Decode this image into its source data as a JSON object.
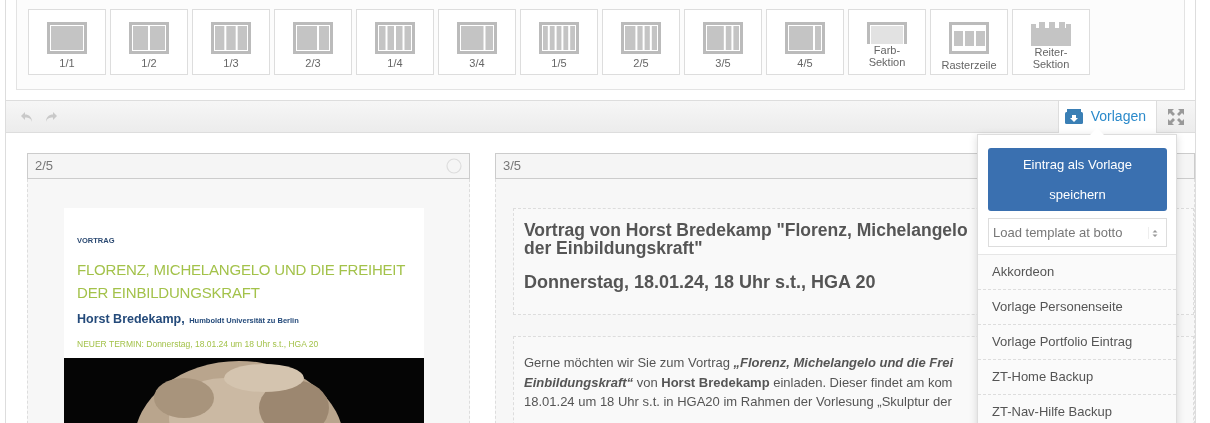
{
  "palette": [
    {
      "label": "1/1",
      "kind": "columns"
    },
    {
      "label": "1/2",
      "kind": "columns"
    },
    {
      "label": "1/3",
      "kind": "columns"
    },
    {
      "label": "2/3",
      "kind": "columns"
    },
    {
      "label": "1/4",
      "kind": "columns"
    },
    {
      "label": "3/4",
      "kind": "columns"
    },
    {
      "label": "1/5",
      "kind": "columns"
    },
    {
      "label": "2/5",
      "kind": "columns"
    },
    {
      "label": "3/5",
      "kind": "columns"
    },
    {
      "label": "4/5",
      "kind": "columns"
    },
    {
      "label": "Farb-\nSektion",
      "kind": "color-section"
    },
    {
      "label": "Rasterzeile",
      "kind": "grid-row"
    },
    {
      "label": "Reiter-\nSektion",
      "kind": "tab-section"
    }
  ],
  "toolbar": {
    "undo_disabled": true,
    "redo_disabled": true,
    "templates_button": "Vorlagen",
    "templates_expanded": true
  },
  "templates_menu": {
    "save_button": "Eintrag als Vorlage speichern",
    "select_value": "Load template at botto",
    "items": [
      "Akkordeon",
      "Vorlage Personenseite",
      "Vorlage Portfolio Eintrag",
      "ZT-Home Backup",
      "ZT-Nav-Hilfe Backup"
    ]
  },
  "columns": [
    {
      "label": "2/5",
      "kind": "poster",
      "poster": {
        "eyebrow": "VORTRAG",
        "title": "FLORENZ, MICHELANGELO UND DIE FREIHEIT DER EINBILDUNGSKRAFT",
        "speaker": "Horst Bredekamp,",
        "affiliation": "Humboldt Universität zu Berlin",
        "date": "NEUER TERMIN: Donnerstag, 18.01.24 um 18 Uhr s.t., HGA 20"
      }
    },
    {
      "label": "3/5",
      "kind": "text",
      "heading_lines": [
        "Vortrag von Horst Bredekamp \"Florenz, Michelangelo",
        "der Einbildungskraft\""
      ],
      "subheading": "Donnerstag, 18.01.24, 18 Uhr s.t., HGA 20",
      "paragraph_lines": [
        "Gerne möchten wir Sie zum Vortrag *„Florenz, Michelangelo und die Frei*",
        "*Einbildungskraft“* von **Horst Bredekamp** einladen. Dieser findet am kom",
        "18.01.24 um 18 Uhr s.t. in HGA20 im Rahmen der Vorlesung „Skulptur der"
      ]
    }
  ]
}
